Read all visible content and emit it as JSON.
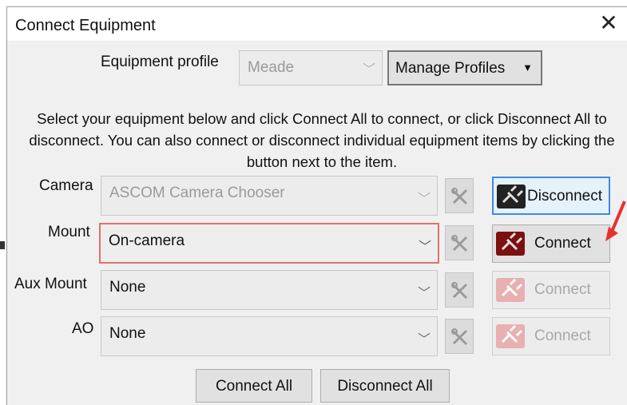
{
  "window": {
    "title": "Connect Equipment"
  },
  "profile": {
    "label": "Equipment profile",
    "value": "Meade",
    "manage_label": "Manage Profiles"
  },
  "description": "Select your equipment below and click Connect All to connect, or click Disconnect All to disconnect. You can also connect or disconnect individual equipment items by clicking the button next to the item.",
  "rows": [
    {
      "label": "Camera",
      "value": "ASCOM Camera Chooser",
      "button": "Disconnect"
    },
    {
      "label": "Mount",
      "value": "On-camera",
      "button": "Connect"
    },
    {
      "label": "Aux Mount",
      "value": "None",
      "button": "Connect"
    },
    {
      "label": "AO",
      "value": "None",
      "button": "Connect"
    }
  ],
  "footer": {
    "connect_all": "Connect All",
    "disconnect_all": "Disconnect All"
  },
  "icons": {
    "close": "close-icon",
    "chevron": "chevron-down-icon",
    "setup": "tools-icon",
    "plug": "plug-icon",
    "dropdown_arrow": "caret-down-icon"
  },
  "colors": {
    "annotation_arrow": "#e8302a",
    "focus_border": "#3c8be0",
    "error_border": "#e07070"
  }
}
